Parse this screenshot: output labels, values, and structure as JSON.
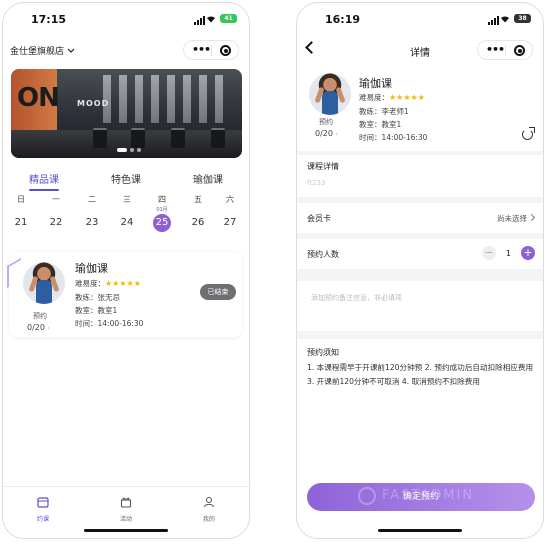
{
  "colors": {
    "accent": "#8b5fd6",
    "tab_active": "#5a4fcf",
    "stars": "#f5b800",
    "battery_left": "#34c759",
    "battery_right": "#333333"
  },
  "left": {
    "status": {
      "time": "17:15",
      "battery": "41"
    },
    "header": {
      "store": "金仕堡旗舰店"
    },
    "tabs": [
      "精品课",
      "特色课",
      "瑜伽课"
    ],
    "week": [
      {
        "wd": "日",
        "day": "21"
      },
      {
        "wd": "一",
        "day": "22"
      },
      {
        "wd": "二",
        "day": "23"
      },
      {
        "wd": "三",
        "day": "24"
      },
      {
        "wd": "四",
        "day": "25",
        "month": "01月",
        "selected": true
      },
      {
        "wd": "五",
        "day": "26"
      },
      {
        "wd": "六",
        "day": "27"
      }
    ],
    "course": {
      "title": "瑜伽课",
      "difficulty_label": "难易度：",
      "stars": "★★★★★",
      "coach": "教练：张无忌",
      "room": "教室：教室1",
      "time": "时间：14:00-16:30",
      "book_label": "预约",
      "count": "0/20",
      "status": "已结束"
    },
    "tabbar": [
      "约课",
      "活动",
      "我的"
    ]
  },
  "right": {
    "status": {
      "time": "16:19",
      "battery": "38"
    },
    "header": {
      "title": "详情"
    },
    "course": {
      "title": "瑜伽课",
      "difficulty_label": "难易度：",
      "stars": "★★★★★",
      "coach": "教练：李老师1",
      "room": "教室：教室1",
      "time": "时间：14:00-16:30",
      "book_label": "预约",
      "count": "0/20"
    },
    "detail": {
      "heading": "课程详情",
      "value": "ft233"
    },
    "member_card": {
      "label": "会员卡",
      "value": "尚未选择"
    },
    "people": {
      "label": "预约人数",
      "qty": "1",
      "minus": "−",
      "plus": "+"
    },
    "remark": {
      "placeholder": "添加预约备注信息，非必填项"
    },
    "notice": {
      "heading": "预约须知",
      "text": "1. 本课程需早于开课前120分钟预 2. 预约成功后自动扣除相应费用 3. 开课前120分钟不可取消 4. 取消预约不扣除费用"
    },
    "confirm": "确定预约",
    "watermark": "FASTADMIN"
  }
}
